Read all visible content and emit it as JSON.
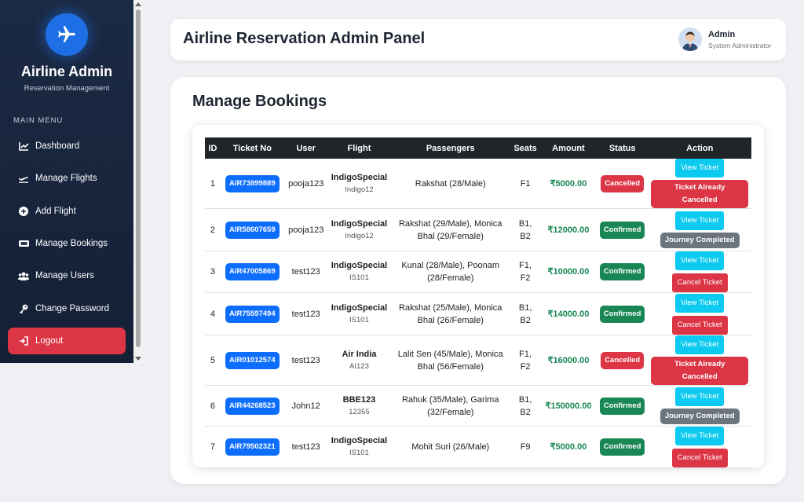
{
  "sidebar": {
    "brand": "Airline Admin",
    "subtitle": "Reservation Management",
    "menu_heading": "MAIN MENU",
    "items": [
      {
        "label": "Dashboard",
        "icon": "chart-line-icon"
      },
      {
        "label": "Manage Flights",
        "icon": "plane-departure-icon"
      },
      {
        "label": "Add Flight",
        "icon": "plus-circle-icon"
      },
      {
        "label": "Manage Bookings",
        "icon": "ticket-icon"
      },
      {
        "label": "Manage Users",
        "icon": "users-icon"
      },
      {
        "label": "Change Password",
        "icon": "key-icon"
      },
      {
        "label": "Logout",
        "icon": "logout-icon"
      }
    ]
  },
  "header": {
    "title": "Airline Reservation Admin Panel",
    "user_name": "Admin",
    "user_role": "System Administrator"
  },
  "main": {
    "title": "Manage Bookings",
    "columns": [
      "ID",
      "Ticket No",
      "User",
      "Flight",
      "Passengers",
      "Seats",
      "Amount",
      "Status",
      "Action"
    ],
    "rows": [
      {
        "id": "1",
        "ticket": "AIR73899889",
        "user": "pooja123",
        "flight": "IndigoSpecial",
        "flight_code": "Indigo12",
        "passengers": "Rakshat (28/Male)",
        "seats": "F1",
        "amount": "₹5000.00",
        "status": "Cancelled",
        "view": "View Ticket",
        "action": "Ticket Already Cancelled",
        "action_type": "red-badge"
      },
      {
        "id": "2",
        "ticket": "AIR58607659",
        "user": "pooja123",
        "flight": "IndigoSpecial",
        "flight_code": "Indigo12",
        "passengers": "Rakshat (29/Male), Monica Bhal (29/Female)",
        "seats": "B1, B2",
        "amount": "₹12000.00",
        "status": "Confirmed",
        "view": "View Ticket",
        "action": "Journey Completed",
        "action_type": "gray-badge"
      },
      {
        "id": "3",
        "ticket": "AIR47005869",
        "user": "test123",
        "flight": "IndigoSpecial",
        "flight_code": "IS101",
        "passengers": "Kunal (28/Male), Poonam (28/Female)",
        "seats": "F1, F2",
        "amount": "₹10000.00",
        "status": "Confirmed",
        "view": "View Ticket",
        "action": "Cancel Ticket",
        "action_type": "button"
      },
      {
        "id": "4",
        "ticket": "AIR75597494",
        "user": "test123",
        "flight": "IndigoSpecial",
        "flight_code": "IS101",
        "passengers": "Rakshat (25/Male), Monica Bhal (26/Female)",
        "seats": "B1, B2",
        "amount": "₹14000.00",
        "status": "Confirmed",
        "view": "View Ticket",
        "action": "Cancel Ticket",
        "action_type": "button"
      },
      {
        "id": "5",
        "ticket": "AIR01012574",
        "user": "test123",
        "flight": "Air India",
        "flight_code": "AI123",
        "passengers": "Lalit Sen (45/Male), Monica Bhal (56/Female)",
        "seats": "F1, F2",
        "amount": "₹16000.00",
        "status": "Cancelled",
        "view": "View Ticket",
        "action": "Ticket Already Cancelled",
        "action_type": "red-badge"
      },
      {
        "id": "6",
        "ticket": "AIR44268523",
        "user": "John12",
        "flight": "BBE123",
        "flight_code": "12355",
        "passengers": "Rahuk (35/Male), Garima (32/Female)",
        "seats": "B1, B2",
        "amount": "₹150000.00",
        "status": "Confirmed",
        "view": "View Ticket",
        "action": "Journey Completed",
        "action_type": "gray-badge"
      },
      {
        "id": "7",
        "ticket": "AIR79502321",
        "user": "test123",
        "flight": "IndigoSpecial",
        "flight_code": "IS101",
        "passengers": "Mohit Suri (26/Male)",
        "seats": "F9",
        "amount": "₹5000.00",
        "status": "Confirmed",
        "view": "View Ticket",
        "action": "Cancel Ticket",
        "action_type": "button"
      }
    ]
  },
  "colors": {
    "accent": "#0d6efd",
    "danger": "#dc3545",
    "success": "#198754",
    "info": "#0dcaf0",
    "sidebar_bg": "#1b2a44"
  }
}
